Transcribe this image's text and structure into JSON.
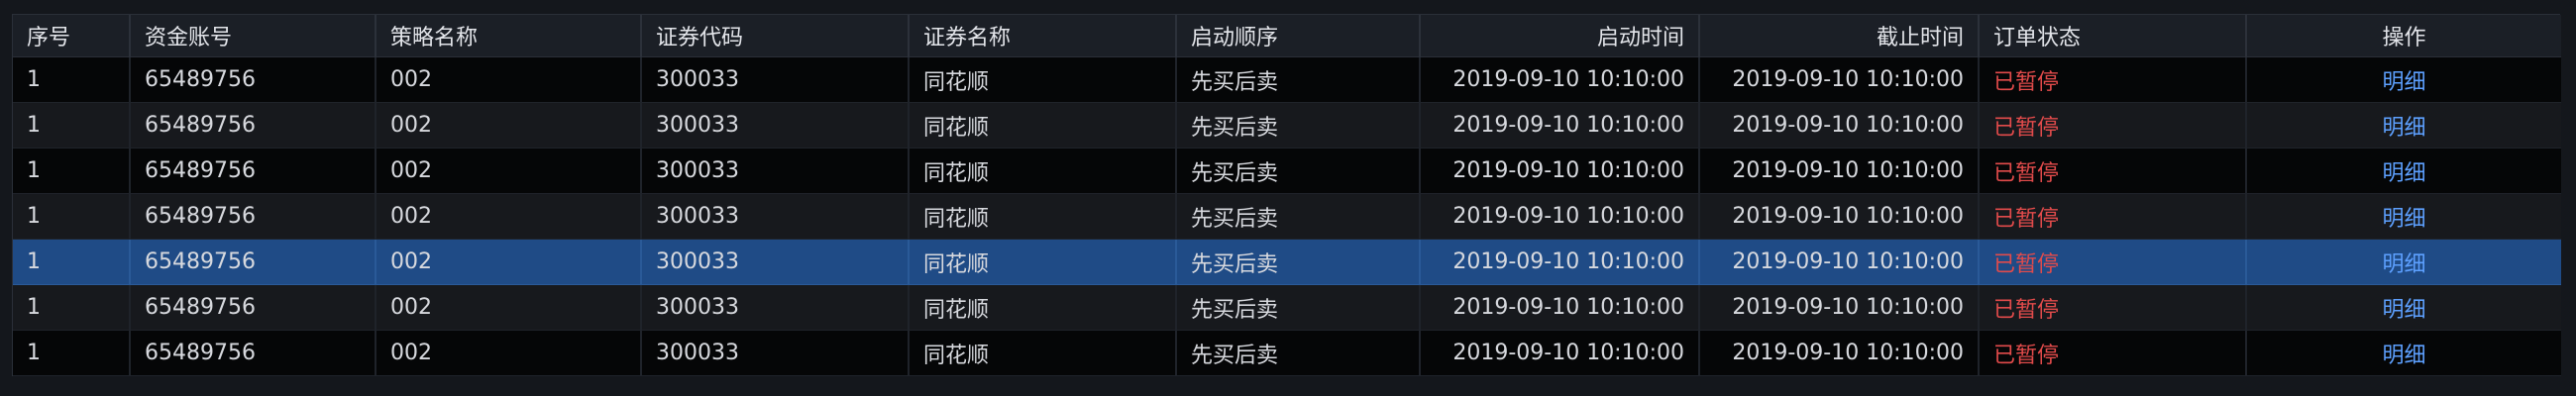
{
  "table": {
    "columns": [
      {
        "label": "序号"
      },
      {
        "label": "资金账号"
      },
      {
        "label": "策略名称"
      },
      {
        "label": "证券代码"
      },
      {
        "label": "证券名称"
      },
      {
        "label": "启动顺序"
      },
      {
        "label": "启动时间"
      },
      {
        "label": "截止时间"
      },
      {
        "label": "订单状态"
      },
      {
        "label": "操作"
      }
    ],
    "rows": [
      {
        "index": "1",
        "account": "65489756",
        "strategy": "002",
        "code": "300033",
        "name": "同花顺",
        "order": "先买后卖",
        "start": "2019-09-10  10:10:00",
        "end": "2019-09-10  10:10:00",
        "status": "已暂停",
        "action": "明细"
      },
      {
        "index": "1",
        "account": "65489756",
        "strategy": "002",
        "code": "300033",
        "name": "同花顺",
        "order": "先买后卖",
        "start": "2019-09-10  10:10:00",
        "end": "2019-09-10  10:10:00",
        "status": "已暂停",
        "action": "明细"
      },
      {
        "index": "1",
        "account": "65489756",
        "strategy": "002",
        "code": "300033",
        "name": "同花顺",
        "order": "先买后卖",
        "start": "2019-09-10  10:10:00",
        "end": "2019-09-10  10:10:00",
        "status": "已暂停",
        "action": "明细"
      },
      {
        "index": "1",
        "account": "65489756",
        "strategy": "002",
        "code": "300033",
        "name": "同花顺",
        "order": "先买后卖",
        "start": "2019-09-10  10:10:00",
        "end": "2019-09-10  10:10:00",
        "status": "已暂停",
        "action": "明细"
      },
      {
        "index": "1",
        "account": "65489756",
        "strategy": "002",
        "code": "300033",
        "name": "同花顺",
        "order": "先买后卖",
        "start": "2019-09-10  10:10:00",
        "end": "2019-09-10  10:10:00",
        "status": "已暂停",
        "action": "明细"
      },
      {
        "index": "1",
        "account": "65489756",
        "strategy": "002",
        "code": "300033",
        "name": "同花顺",
        "order": "先买后卖",
        "start": "2019-09-10  10:10:00",
        "end": "2019-09-10  10:10:00",
        "status": "已暂停",
        "action": "明细"
      },
      {
        "index": "1",
        "account": "65489756",
        "strategy": "002",
        "code": "300033",
        "name": "同花顺",
        "order": "先买后卖",
        "start": "2019-09-10  10:10:00",
        "end": "2019-09-10  10:10:00",
        "status": "已暂停",
        "action": "明细"
      }
    ],
    "selected_row": 4
  },
  "colors": {
    "status_paused": "#e24b4b",
    "action_link": "#5da0ff",
    "row_selected": "#1f4b86",
    "header_bg": "#1b1f26"
  }
}
